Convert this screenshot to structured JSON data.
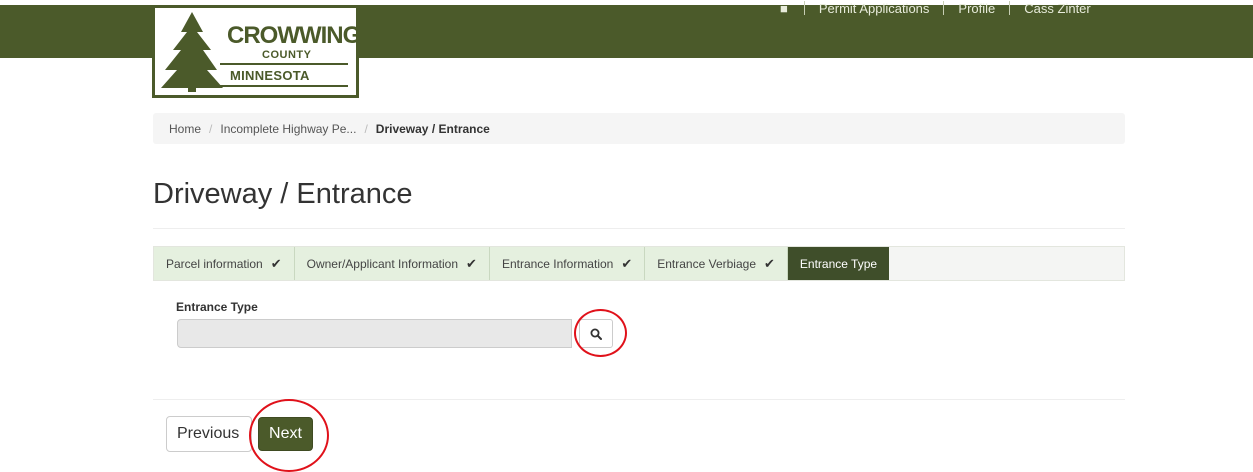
{
  "header": {
    "logo": {
      "line1": "CROWWING",
      "line2": "COUNTY",
      "line3": "MINNESOTA"
    },
    "nav": {
      "items": [
        "Permit Applications",
        "Profile",
        "Cass Zinter"
      ]
    },
    "colors": {
      "brand": "#4b5a2a"
    }
  },
  "breadcrumb": {
    "items": [
      "Home",
      "Incomplete Highway Pe...",
      "Driveway / Entrance"
    ],
    "separator": "/"
  },
  "page": {
    "title": "Driveway / Entrance"
  },
  "wizard": {
    "steps": [
      {
        "label": "Parcel information",
        "completed": true
      },
      {
        "label": "Owner/Applicant Information",
        "completed": true
      },
      {
        "label": "Entrance Information",
        "completed": true
      },
      {
        "label": "Entrance Verbiage",
        "completed": true
      },
      {
        "label": "Entrance Type",
        "completed": false,
        "active": true
      }
    ],
    "check_glyph": "✔"
  },
  "form": {
    "entrance_type": {
      "label": "Entrance Type",
      "value": "",
      "search_icon": "search-icon"
    }
  },
  "actions": {
    "previous": "Previous",
    "next": "Next"
  },
  "annotations": {
    "highlight_color": "#e0111a"
  }
}
